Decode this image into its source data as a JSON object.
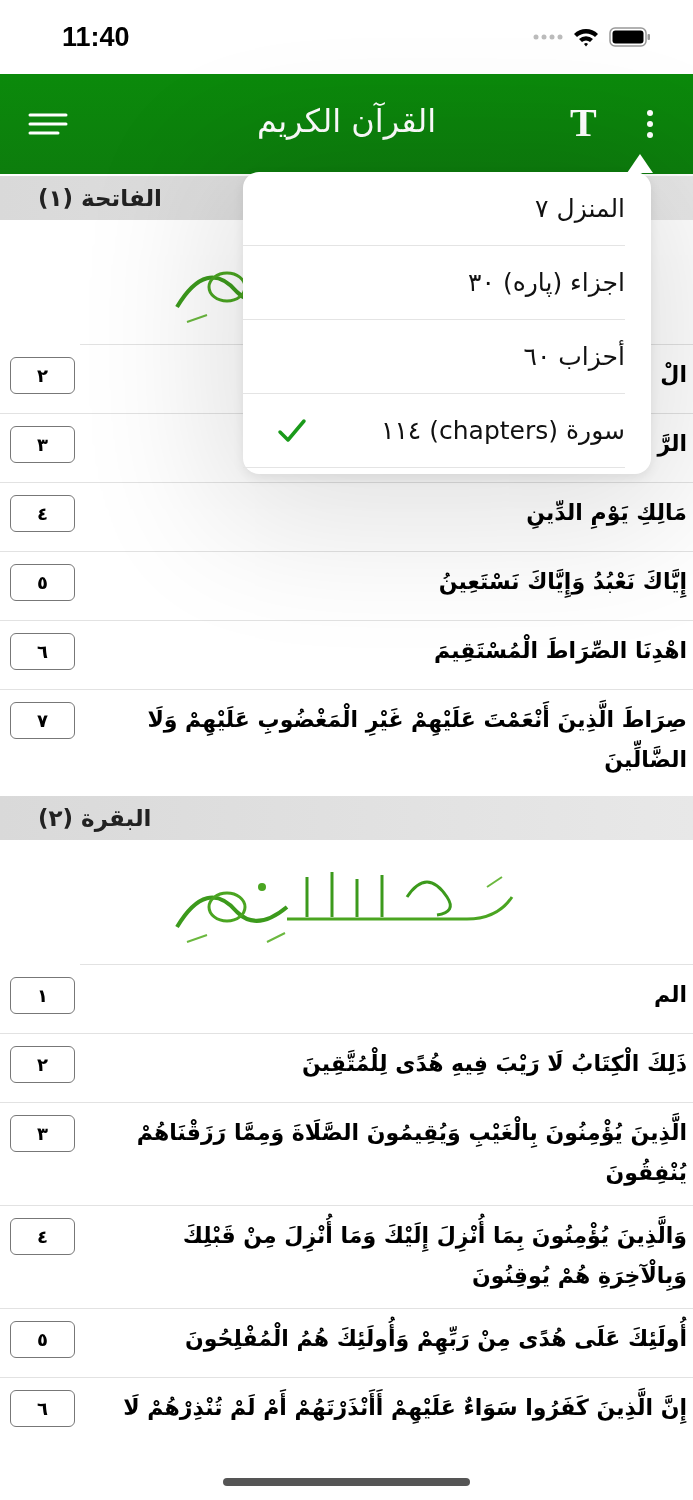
{
  "status_bar": {
    "time": "11:40"
  },
  "header": {
    "title": "القرآن الكريم",
    "font_button": "T"
  },
  "menu": {
    "items": [
      {
        "label": "المنزل ٧",
        "selected": false
      },
      {
        "label": "اجزاء (پاره) ٣٠",
        "selected": false
      },
      {
        "label": "أحزاب ٦٠",
        "selected": false
      },
      {
        "label": "سورة (chapters) ١١٤",
        "selected": true
      }
    ]
  },
  "sections": [
    {
      "title": "الفاتحة (١)",
      "verses": [
        {
          "number": "٢",
          "text": "الْ"
        },
        {
          "number": "٣",
          "text": "الرَّ"
        },
        {
          "number": "٤",
          "text": "مَالِكِ يَوْمِ الدِّينِ"
        },
        {
          "number": "٥",
          "text": "إِيَّاكَ نَعْبُدُ وَإِيَّاكَ نَسْتَعِينُ"
        },
        {
          "number": "٦",
          "text": "اهْدِنَا الصِّرَاطَ الْمُسْتَقِيمَ"
        },
        {
          "number": "٧",
          "text": "صِرَاطَ الَّذِينَ أَنْعَمْتَ عَلَيْهِمْ غَيْرِ الْمَغْضُوبِ عَلَيْهِمْ وَلَا الضَّالِّينَ"
        }
      ]
    },
    {
      "title": "البقرة (٢)",
      "verses": [
        {
          "number": "١",
          "text": "الم"
        },
        {
          "number": "٢",
          "text": "ذَلِكَ الْكِتَابُ لَا رَيْبَ فِيهِ هُدًى لِلْمُتَّقِينَ"
        },
        {
          "number": "٣",
          "text": "الَّذِينَ يُؤْمِنُونَ بِالْغَيْبِ وَيُقِيمُونَ الصَّلَاةَ وَمِمَّا رَزَقْنَاهُمْ يُنْفِقُونَ"
        },
        {
          "number": "٤",
          "text": "وَالَّذِينَ يُؤْمِنُونَ بِمَا أُنْزِلَ إِلَيْكَ وَمَا أُنْزِلَ مِنْ قَبْلِكَ وَبِالْآخِرَةِ هُمْ يُوقِنُونَ"
        },
        {
          "number": "٥",
          "text": "أُولَئِكَ عَلَى هُدًى مِنْ رَبِّهِمْ وَأُولَئِكَ هُمُ الْمُفْلِحُونَ"
        },
        {
          "number": "٦",
          "text": "إِنَّ الَّذِينَ كَفَرُوا سَوَاءٌ عَلَيْهِمْ أَأَنْذَرْتَهُمْ أَمْ لَمْ تُنْذِرْهُمْ لَا"
        }
      ]
    }
  ]
}
